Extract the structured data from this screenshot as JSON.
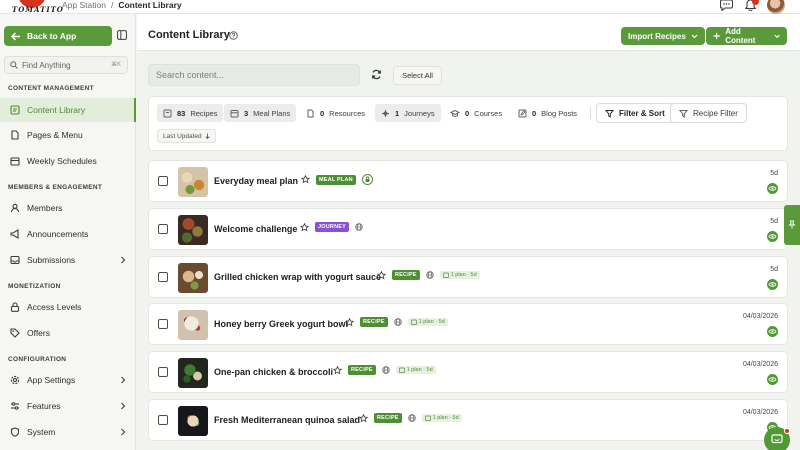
{
  "brand": {
    "logo_text": "TOMATITO"
  },
  "breadcrumb": {
    "root": "App Station",
    "separator": "/",
    "current": "Content Library"
  },
  "topbar_icons": [
    "chat-bubble-icon",
    "bell-icon",
    "avatar"
  ],
  "sidebar": {
    "back_label": "Back to App",
    "find_placeholder": "Find Anything",
    "find_shortcut": "⌘K",
    "sections": [
      {
        "title": "CONTENT MANAGEMENT",
        "items": [
          {
            "label": "Content Library",
            "icon": "library-icon",
            "active": true
          },
          {
            "label": "Pages & Menu",
            "icon": "pages-icon"
          },
          {
            "label": "Weekly Schedules",
            "icon": "calendar-icon"
          }
        ]
      },
      {
        "title": "MEMBERS & ENGAGEMENT",
        "items": [
          {
            "label": "Members",
            "icon": "members-icon"
          },
          {
            "label": "Announcements",
            "icon": "megaphone-icon"
          },
          {
            "label": "Submissions",
            "icon": "inbox-icon",
            "chevron": true
          }
        ]
      },
      {
        "title": "MONETIZATION",
        "items": [
          {
            "label": "Access Levels",
            "icon": "lock-icon"
          },
          {
            "label": "Offers",
            "icon": "tag-icon"
          }
        ]
      },
      {
        "title": "CONFIGURATION",
        "items": [
          {
            "label": "App Settings",
            "icon": "gear-icon",
            "chevron": true
          },
          {
            "label": "Features",
            "icon": "features-icon",
            "chevron": true
          },
          {
            "label": "System",
            "icon": "shield-icon",
            "chevron": true
          }
        ]
      }
    ]
  },
  "header": {
    "title": "Content Library",
    "import_label": "Import Recipes",
    "add_label": "Add Content"
  },
  "toolbar": {
    "search_placeholder": "Search content...",
    "select_all": "Select All"
  },
  "filters": {
    "chips": [
      {
        "count": "83",
        "label": "Recipes",
        "highlighted": true
      },
      {
        "count": "3",
        "label": "Meal Plans",
        "highlighted": true
      },
      {
        "count": "0",
        "label": "Resources",
        "highlighted": false
      },
      {
        "count": "1",
        "label": "Journeys",
        "highlighted": true
      },
      {
        "count": "0",
        "label": "Courses",
        "highlighted": false
      },
      {
        "count": "0",
        "label": "Blog Posts",
        "highlighted": false
      }
    ],
    "filter_sort": "Filter & Sort",
    "recipe_filter": "Recipe Filter",
    "sort_label": "Last Updated"
  },
  "rows": [
    {
      "title": "Everyday meal plan",
      "badge": "MEAL PLAN",
      "badge_type": "meal",
      "extra_icon": "lock",
      "plan": "",
      "date": "5d"
    },
    {
      "title": "Welcome challenge",
      "badge": "JOURNEY",
      "badge_type": "journey",
      "extra_icon": "globe",
      "plan": "",
      "date": "5d"
    },
    {
      "title": "Grilled chicken wrap with yogurt sauce",
      "badge": "RECIPE",
      "badge_type": "recipe",
      "extra_icon": "globe",
      "plan": "1 plan · 5d",
      "date": "5d"
    },
    {
      "title": "Honey berry Greek yogurt bowl",
      "badge": "RECIPE",
      "badge_type": "recipe",
      "extra_icon": "globe",
      "plan": "1 plan · 5d",
      "date": "04/03/2026"
    },
    {
      "title": "One-pan chicken & broccoli",
      "badge": "RECIPE",
      "badge_type": "recipe",
      "extra_icon": "globe",
      "plan": "1 plan · 5d",
      "date": "04/03/2026"
    },
    {
      "title": "Fresh Mediterranean quinoa salad",
      "badge": "RECIPE",
      "badge_type": "recipe",
      "extra_icon": "globe",
      "plan": "1 plan · 5d",
      "date": "04/03/2026"
    }
  ]
}
